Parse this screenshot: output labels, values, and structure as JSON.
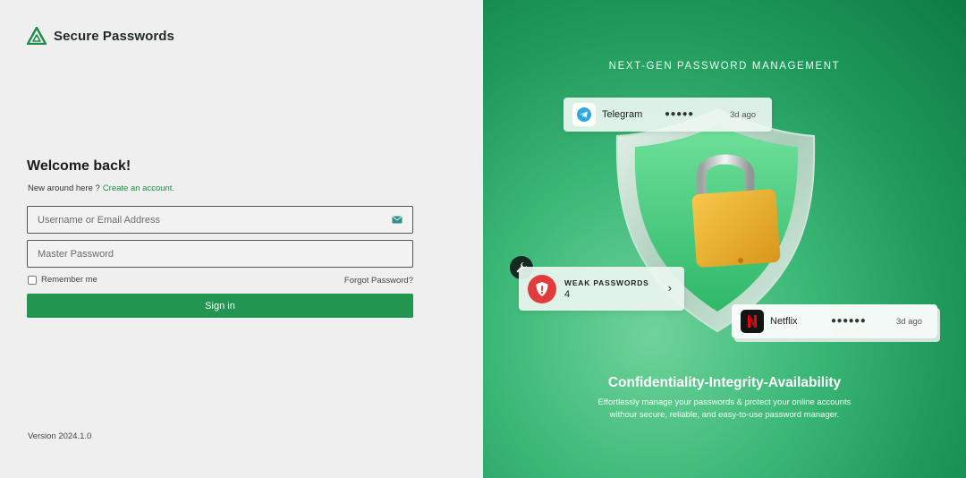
{
  "brand": {
    "name": "Secure Passwords",
    "logo_icon": "triangle-logo-icon"
  },
  "login": {
    "heading": "Welcome back!",
    "signup_prompt": "New around here ?",
    "signup_link": "Create an account.",
    "username_placeholder": "Username or Email Address",
    "password_placeholder": "Master Password",
    "remember_label": "Remember me",
    "forgot_label": "Forgot Password?",
    "signin_label": "Sign in"
  },
  "footer": {
    "version": "Version 2024.1.0"
  },
  "hero": {
    "heading": "NEXT-GEN PASSWORD MANAGEMENT",
    "cards": {
      "telegram": {
        "name": "Telegram",
        "dots": "●●●●●",
        "ago": "3d ago"
      },
      "weak": {
        "title": "WEAK PASSWORDS",
        "count": "4"
      },
      "netflix": {
        "name": "Netflix",
        "dots": "●●●●●●",
        "ago": "3d ago"
      }
    },
    "tagline": "Confidentiality-Integrity-Availability",
    "description_line1": "Effortlessly manage your passwords & protect your online accounts",
    "description_line2": "withour secure, reliable, and easy-to-use password manager."
  },
  "colors": {
    "accent": "#229550",
    "link": "#1e8b46",
    "lock_gold": "#f0b429",
    "alert_red": "#e23b3b"
  }
}
